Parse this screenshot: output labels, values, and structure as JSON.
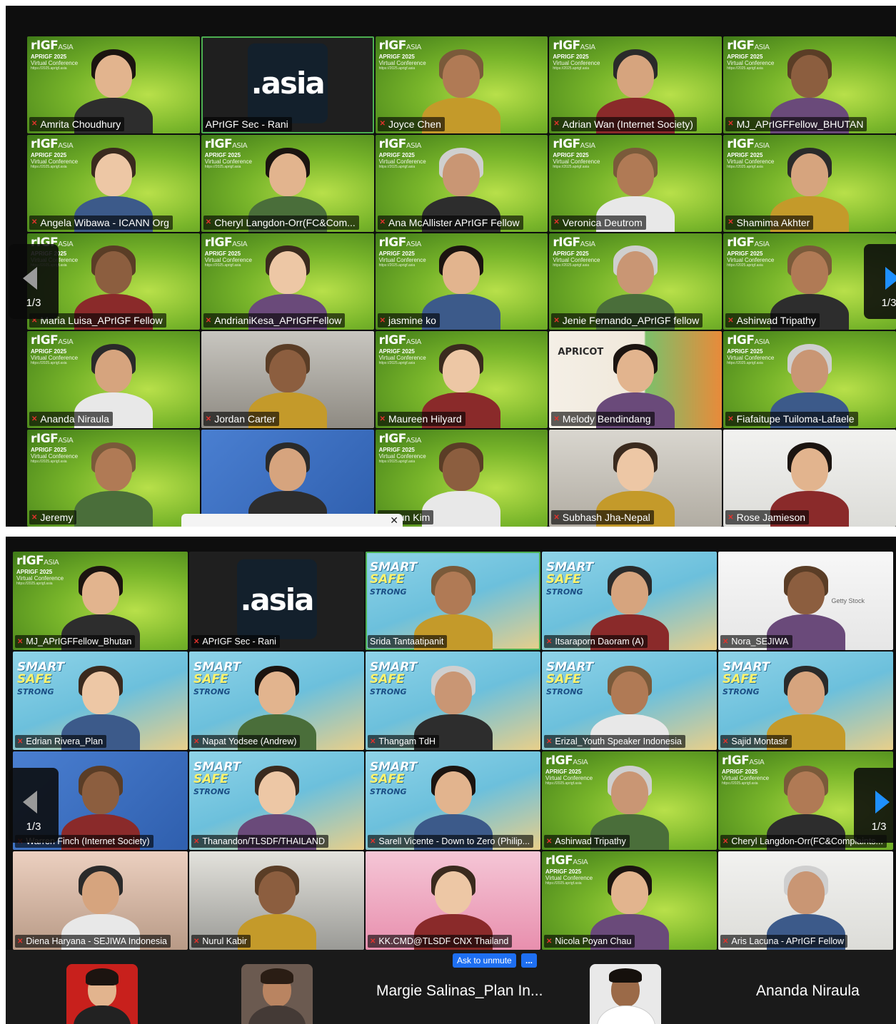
{
  "screen1": {
    "tiles": [
      {
        "name": "Amrita Choudhury",
        "bg": "green",
        "muted": true
      },
      {
        "name": "APrIGF Sec - Rani",
        "bg": "dark",
        "muted": false,
        "active": true,
        "logo": ".asia"
      },
      {
        "name": "Joyce Chen",
        "bg": "green",
        "muted": true
      },
      {
        "name": "Adrian Wan (Internet Society)",
        "bg": "green",
        "muted": true
      },
      {
        "name": "MJ_APrIGFFellow_BHUTAN",
        "bg": "green",
        "muted": true
      },
      {
        "name": "Angela Wibawa - ICANN Org",
        "bg": "green",
        "muted": true
      },
      {
        "name": "Cheryl Langdon-Orr(FC&Com...",
        "bg": "green",
        "muted": true
      },
      {
        "name": "Ana McAllister APrIGF Fellow",
        "bg": "green",
        "muted": true
      },
      {
        "name": "Veronica Deutrom",
        "bg": "green",
        "muted": true
      },
      {
        "name": "Shamima Akhter",
        "bg": "green",
        "muted": true
      },
      {
        "name": "Maria Luisa_APrIGF Fellow",
        "bg": "green",
        "muted": true
      },
      {
        "name": "AndrianiKesa_APrIGFFellow",
        "bg": "green",
        "muted": true
      },
      {
        "name": "jasmine ko",
        "bg": "green",
        "muted": true
      },
      {
        "name": "Jenie Fernando_APrIGF fellow",
        "bg": "green",
        "muted": true
      },
      {
        "name": "Ashirwad Tripathy",
        "bg": "green",
        "muted": true
      },
      {
        "name": "Ananda Niraula",
        "bg": "green",
        "muted": true
      },
      {
        "name": "Jordan Carter",
        "bg": "office",
        "muted": true
      },
      {
        "name": "Maureen Hilyard",
        "bg": "green",
        "muted": true
      },
      {
        "name": "Melody Bendindang",
        "bg": "apricot",
        "muted": true,
        "badge": "APRICOT"
      },
      {
        "name": "Fiafaitupe Tuiloma-Lafaele",
        "bg": "green",
        "muted": true
      },
      {
        "name": "Jeremy",
        "bg": "green",
        "muted": true
      },
      {
        "name": "",
        "bg": "blue",
        "muted": true
      },
      {
        "name": "hyun Kim",
        "bg": "green",
        "muted": true
      },
      {
        "name": "Subhash Jha-Nepal",
        "bg": "room",
        "muted": true
      },
      {
        "name": "Rose Jamieson",
        "bg": "white",
        "muted": true
      }
    ],
    "nav_left_page": "1/3",
    "nav_right_page": "1/3"
  },
  "screen2": {
    "tiles": [
      {
        "name": "MJ_APrIGFFellow_Bhutan",
        "bg": "green",
        "muted": true
      },
      {
        "name": "APrIGF Sec - Rani",
        "bg": "dark",
        "muted": true,
        "logo": ".asia"
      },
      {
        "name": "Srida Tantaatipanit",
        "bg": "smart",
        "muted": false,
        "active": true
      },
      {
        "name": "Itsaraporn Daoram (A)",
        "bg": "smart",
        "muted": true
      },
      {
        "name": "Nora_SEJIWA",
        "bg": "whiteroom",
        "muted": true,
        "watermark": "Getty Stock"
      },
      {
        "name": "Edrian Rivera_Plan",
        "bg": "smart",
        "muted": true
      },
      {
        "name": "Napat Yodsee (Andrew)",
        "bg": "smart",
        "muted": true
      },
      {
        "name": "Thangam TdH",
        "bg": "smart",
        "muted": true
      },
      {
        "name": "Erizal_Youth Speaker Indonesia",
        "bg": "smart",
        "muted": true
      },
      {
        "name": "Sajid Montasir",
        "bg": "smart",
        "muted": true
      },
      {
        "name": "Warren Finch (Internet Society)",
        "bg": "blue",
        "muted": true
      },
      {
        "name": "Thanandon/TLSDF/THAILAND",
        "bg": "smart",
        "muted": true
      },
      {
        "name": "Sarell Vicente - Down to Zero (Philip...",
        "bg": "smart",
        "muted": true
      },
      {
        "name": "Ashirwad Tripathy",
        "bg": "green",
        "muted": true
      },
      {
        "name": "Cheryl Langdon-Orr(FC&Complaints...",
        "bg": "green",
        "muted": true
      },
      {
        "name": "Diena Haryana - SEJIWA Indonesia",
        "bg": "photo",
        "muted": true
      },
      {
        "name": "Nurul Kabir",
        "bg": "hall",
        "muted": true
      },
      {
        "name": "KK.CMD@TLSDF CNX Thailand",
        "bg": "classroom",
        "muted": true
      },
      {
        "name": "Nicola Poyan Chau",
        "bg": "green",
        "muted": true
      },
      {
        "name": "Aris Lacuna - APrIGF Fellow",
        "bg": "white",
        "muted": true
      }
    ],
    "nav_left_page": "1/3",
    "nav_right_page": "1/3",
    "strip": {
      "names": [
        "Margie Salinas_Plan In...",
        "Ananda Niraula"
      ],
      "unmute_label": "Ask to unmute",
      "more_label": "..."
    }
  },
  "branding": {
    "logo": "rIGF",
    "logo_suffix": "ASIA",
    "conf_line1": "APRIGF 2025",
    "conf_line2": "Virtual Conference",
    "conf_url": "https://2025.aprigf.asia",
    "smart_line1": "SMART",
    "smart_line2": "SAFE",
    "smart_line3": "STRONG"
  },
  "icons": {
    "mic_muted": "muted-mic-icon",
    "prev": "chevron-left-icon",
    "next": "chevron-right-icon",
    "close": "close-icon"
  },
  "colors": {
    "active_border": "#4caf50",
    "muted_mic": "#e0322c",
    "next_arrow": "#1e90ff",
    "unmute_button": "#1e6ff2"
  }
}
